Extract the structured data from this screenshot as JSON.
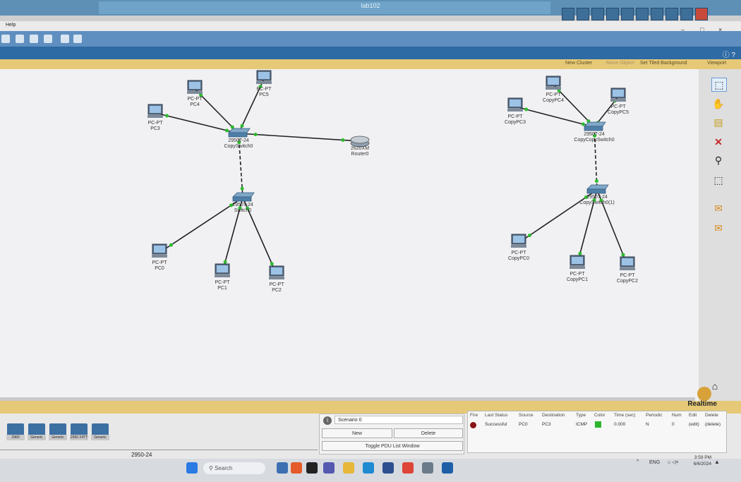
{
  "window": {
    "title": "lab102"
  },
  "menu": {
    "help": "Help"
  },
  "window_controls": {
    "minimize": "–",
    "maximize": "□",
    "close": "×"
  },
  "logical_bar": {
    "new_cluster": "New Cluster",
    "move_object": "Move Object",
    "set_tiled_background": "Set Tiled Background",
    "viewport": "Viewport"
  },
  "realtime": {
    "label": "Realtime"
  },
  "network": {
    "devices": [
      {
        "id": "pc4",
        "type": "pc",
        "model": "PC-PT",
        "name": "PC4"
      },
      {
        "id": "pc5",
        "type": "pc",
        "model": "PC-PT",
        "name": "PC5"
      },
      {
        "id": "pc3",
        "type": "pc",
        "model": "PC-PT",
        "name": "PC3"
      },
      {
        "id": "sw_copy0",
        "type": "switch",
        "model": "2950T-24",
        "name": "CopySwitch0"
      },
      {
        "id": "router0",
        "type": "router",
        "model": "2620XM",
        "name": "Router0"
      },
      {
        "id": "switch0",
        "type": "switch",
        "model": "2950T-24",
        "name": "Switch0"
      },
      {
        "id": "pc0",
        "type": "pc",
        "model": "PC-PT",
        "name": "PC0"
      },
      {
        "id": "pc1",
        "type": "pc",
        "model": "PC-PT",
        "name": "PC1"
      },
      {
        "id": "pc2",
        "type": "pc",
        "model": "PC-PT",
        "name": "PC2"
      },
      {
        "id": "cpc4",
        "type": "pc",
        "model": "PC-PT",
        "name": "CopyPC4"
      },
      {
        "id": "cpc5",
        "type": "pc",
        "model": "PC-PT",
        "name": "CopyPC5"
      },
      {
        "id": "cpc3",
        "type": "pc",
        "model": "PC-PT",
        "name": "CopyPC3"
      },
      {
        "id": "sw_cc0",
        "type": "switch",
        "model": "2950T-24",
        "name": "CopyCopySwitch0"
      },
      {
        "id": "sw_c0_1",
        "type": "switch",
        "model": "2950T-24",
        "name": "CopySwitch0(1)"
      },
      {
        "id": "cpc0",
        "type": "pc",
        "model": "PC-PT",
        "name": "CopyPC0"
      },
      {
        "id": "cpc1",
        "type": "pc",
        "model": "PC-PT",
        "name": "CopyPC1"
      },
      {
        "id": "cpc2",
        "type": "pc",
        "model": "PC-PT",
        "name": "CopyPC2"
      }
    ]
  },
  "bottom": {
    "device_labels": [
      "2960",
      "Generic",
      "Generic",
      "2950 24TT",
      "Generic"
    ],
    "selected_device": "2950-24",
    "scenario": {
      "name": "Scenario 0",
      "new": "New",
      "delete": "Delete",
      "toggle": "Toggle PDU List Window"
    },
    "pdu_table": {
      "headers": [
        "Fire",
        "Last Status",
        "Source",
        "Destination",
        "Type",
        "Color",
        "Time (sec)",
        "Periodic",
        "Num",
        "Edit",
        "Delete"
      ],
      "rows": [
        {
          "fire": "",
          "last_status": "Successful",
          "source": "PC0",
          "destination": "PC3",
          "type": "ICMP",
          "color": "#2db52d",
          "time": "0.000",
          "periodic": "N",
          "num": "0",
          "edit": "(edit)",
          "delete": "(delete)"
        }
      ]
    }
  },
  "taskbar": {
    "search_placeholder": "Search",
    "lang": "ENG",
    "time": "3:59 PM",
    "date": "6/6/2024"
  },
  "colors": {
    "link_dot": "#2dbb2d",
    "accent": "#2e6aa3",
    "gold": "#e6c977"
  }
}
